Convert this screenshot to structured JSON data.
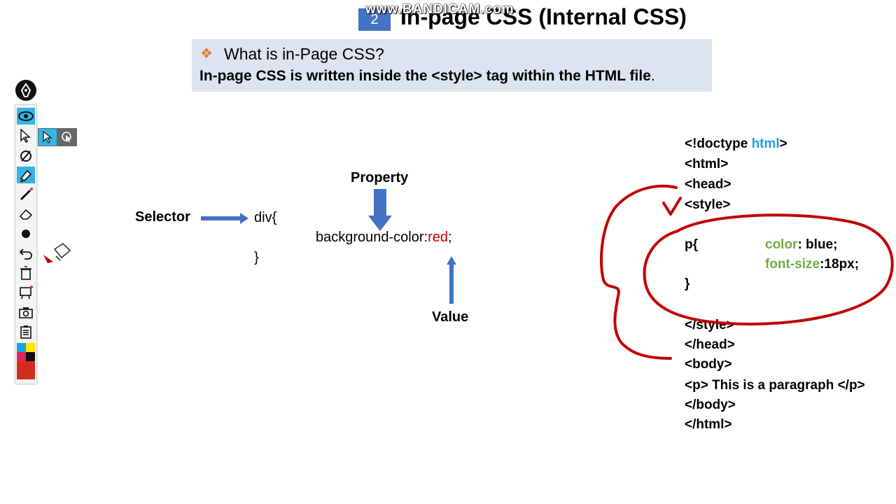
{
  "slide": {
    "number": "2",
    "title": "In-page CSS (Internal CSS)",
    "watermark": "www.BANDICAM.com"
  },
  "info_box": {
    "question": "What is in-Page CSS?",
    "answer": "In-page CSS is written inside the <style> tag within the HTML file",
    "answer_end": "."
  },
  "diagram": {
    "selector_label": "Selector",
    "property_label": "Property",
    "value_label": "Value",
    "code_open": "div{",
    "code_property": "background-color:",
    "code_value": "red",
    "code_semicolon": ";",
    "code_close": "}"
  },
  "source_code": {
    "doctype_a": "<!doctype ",
    "doctype_b": "html",
    "doctype_c": ">",
    "html_open": "<html>",
    "head_open": "<head>",
    "style_open": "<style>",
    "p_rule_open": "p{",
    "prop1_name": "color",
    "prop1_value": ": blue;",
    "prop2_name": "font-size",
    "prop2_value": ":18px;",
    "rule_close": "}",
    "style_close": "</style>",
    "head_close": "</head>",
    "body_open": "<body>",
    "paragraph": "<p>  This is a paragraph </p>",
    "body_close": "</body>",
    "html_close": "</html>"
  },
  "colors": {
    "accent_blue": "#4472c4",
    "keyword_cyan": "#1ba1e2",
    "property_green": "#70ad47",
    "value_red": "#c00000",
    "annotation_red": "#c00000",
    "toolbar_active": "#33b5e5"
  },
  "toolbar": {
    "tools": [
      "eye-icon",
      "cursor-icon",
      "laser-icon",
      "highlighter-icon",
      "pen-icon",
      "eraser-icon",
      "dot-icon",
      "undo-icon",
      "trash-icon",
      "whiteboard-icon",
      "camera-icon",
      "clipboard-icon",
      "color-palette-icon"
    ]
  }
}
